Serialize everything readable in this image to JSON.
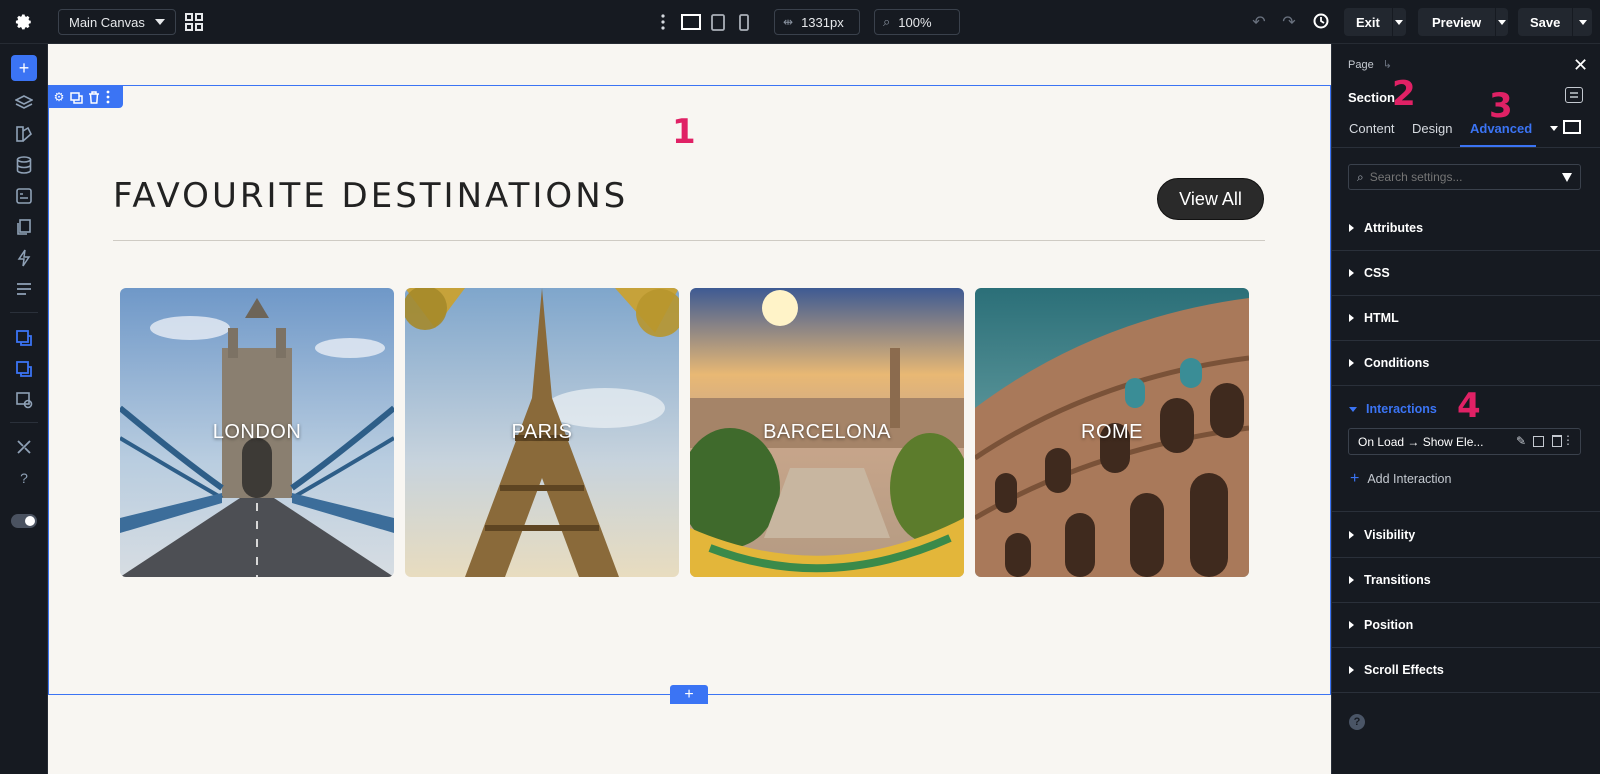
{
  "topbar": {
    "canvas_select": "Main Canvas",
    "width_value": "1331px",
    "zoom_value": "100%",
    "exit_label": "Exit",
    "preview_label": "Preview",
    "save_label": "Save"
  },
  "canvas": {
    "annotation": "1",
    "heading": "FAVOURITE DESTINATIONS",
    "view_all": "View All",
    "cards": [
      {
        "label": "LONDON"
      },
      {
        "label": "PARIS"
      },
      {
        "label": "BARCELONA"
      },
      {
        "label": "ROME"
      }
    ],
    "add_symbol": "+"
  },
  "panel": {
    "breadcrumb": "Page",
    "element_title": "Section",
    "annotation_2": "2",
    "annotation_3": "3",
    "annotation_4": "4",
    "tabs": [
      {
        "label": "Content"
      },
      {
        "label": "Design"
      },
      {
        "label": "Advanced",
        "active": true
      }
    ],
    "search_placeholder": "Search settings...",
    "sections": [
      {
        "label": "Attributes"
      },
      {
        "label": "CSS"
      },
      {
        "label": "HTML"
      },
      {
        "label": "Conditions"
      },
      {
        "label": "Interactions",
        "expanded": true
      },
      {
        "label": "Visibility"
      },
      {
        "label": "Transitions"
      },
      {
        "label": "Position"
      },
      {
        "label": "Scroll Effects"
      }
    ],
    "interaction_item": "On Load → Show Ele...",
    "add_interaction": "Add Interaction",
    "help_symbol": "?"
  },
  "colors": {
    "accent": "#3b74f4",
    "annotation": "#e02165",
    "chrome_bg": "#161a21",
    "canvas_bg": "#f8f6f2"
  }
}
